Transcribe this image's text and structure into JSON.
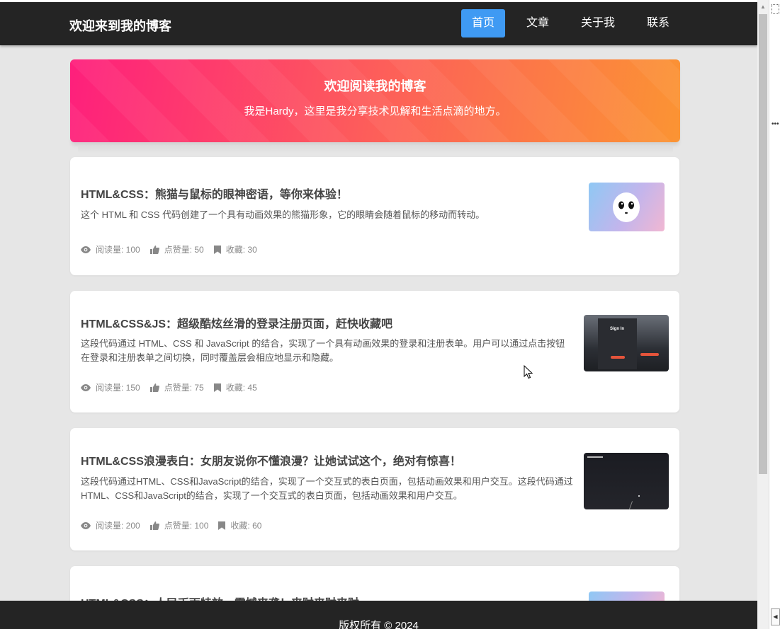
{
  "header": {
    "site_title": "欢迎来到我的博客",
    "nav": [
      "首页",
      "文章",
      "关于我",
      "联系"
    ],
    "active_index": 0
  },
  "hero": {
    "title": "欢迎阅读我的博客",
    "subtitle": "我是Hardy，这里是我分享技术见解和生活点滴的地方。"
  },
  "posts": [
    {
      "title": "HTML&CSS：熊猫与鼠标的眼神密语，等你来体验！",
      "desc": "这个 HTML 和 CSS 代码创建了一个具有动画效果的熊猫形象，它的眼睛会随着鼠标的移动而转动。",
      "views": "阅读量: 100",
      "likes": "点赞量: 50",
      "saves": "收藏: 30"
    },
    {
      "title": "HTML&CSS&JS：超级酷炫丝滑的登录注册页面，赶快收藏吧",
      "desc": "这段代码通过 HTML、CSS 和 JavaScript 的结合，实现了一个具有动画效果的登录和注册表单。用户可以通过点击按钮在登录和注册表单之间切换，同时覆盖层会相应地显示和隐藏。",
      "views": "阅读量: 150",
      "likes": "点赞量: 75",
      "saves": "收藏: 45",
      "thumb_text": "Sign In"
    },
    {
      "title": "HTML&CSS浪漫表白：女朋友说你不懂浪漫？让她试试这个，绝对有惊喜！",
      "desc": "这段代码通过HTML、CSS和JavaScript的结合，实现了一个交互式的表白页面，包括动画效果和用户交互。这段代码通过HTML、CSS和JavaScript的结合，实现了一个交互式的表白页面，包括动画效果和用户交互。",
      "views": "阅读量: 200",
      "likes": "点赞量: 100",
      "saves": "收藏: 60"
    },
    {
      "title": "HTML&CSS：人民币雨特效，震撼来袭！来财来财来财"
    }
  ],
  "footer": {
    "text": "版权所有 © 2024"
  },
  "colors": {
    "nav_bg": "#242424",
    "nav_active": "#3f9af3",
    "hero_gradient": [
      "#fe1f7c",
      "#fb9433"
    ],
    "page_bg": "#e6e6e6"
  },
  "icons": {
    "views": "eye-icon",
    "likes": "thumbs-up-icon",
    "saves": "bookmark-icon"
  }
}
